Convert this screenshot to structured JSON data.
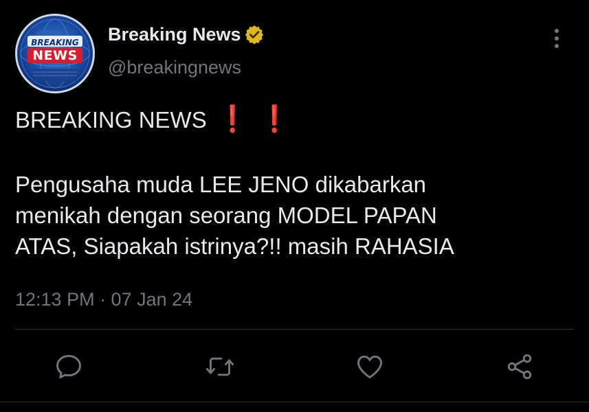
{
  "tweet": {
    "author": {
      "display_name": "Breaking News",
      "handle": "@breakingnews",
      "verified": true,
      "avatar_text_top": "BREAKING",
      "avatar_text_bottom": "NEWS"
    },
    "text": {
      "headline": "BREAKING NEWS",
      "headline_emoji": [
        "❗",
        "❗"
      ],
      "lines": [
        "Pengusaha muda LEE JENO dikabarkan",
        "menikah dengan seorang MODEL PAPAN",
        "ATAS, Siapakah istrinya?!! masih RAHASIA"
      ]
    },
    "timestamp": "12:13 PM · 07 Jan 24",
    "actions": [
      "reply-icon",
      "retweet-icon",
      "like-icon",
      "share-icon"
    ]
  },
  "colors": {
    "background": "#000000",
    "primary_text": "#e7e9ea",
    "secondary_text": "#71767b",
    "divider": "#2f3336",
    "verified_badge": "#e2b719",
    "emoji_red": "#e0242e"
  }
}
